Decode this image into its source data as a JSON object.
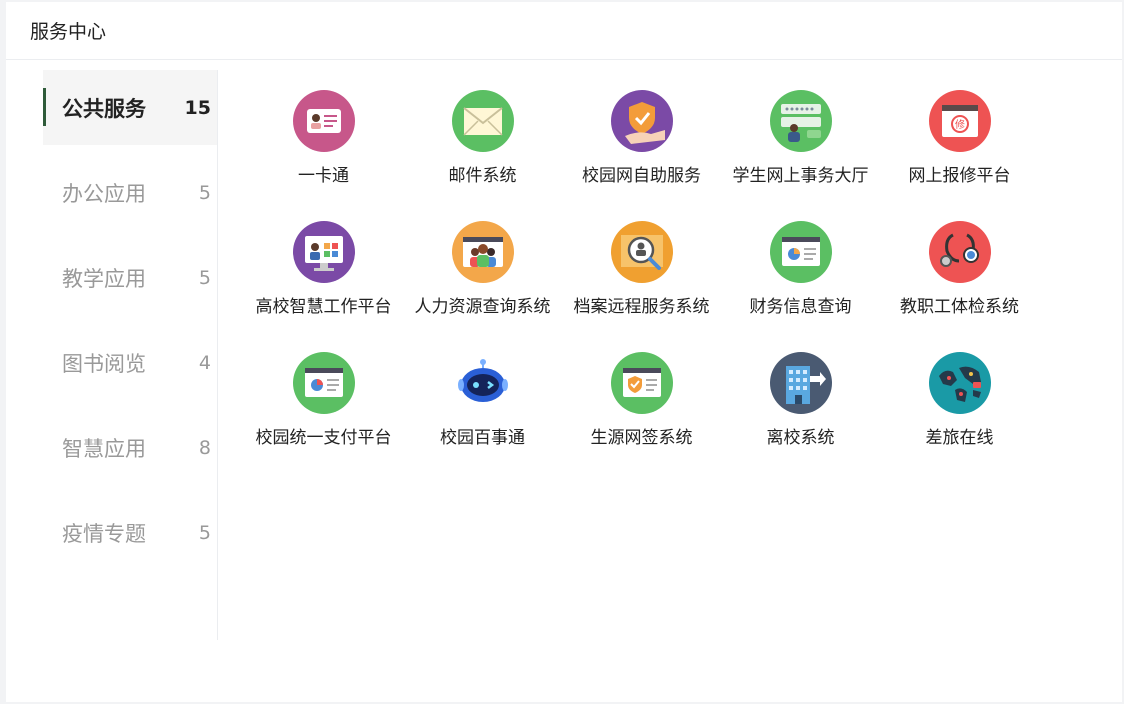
{
  "header": {
    "title": "服务中心"
  },
  "sidebar": {
    "items": [
      {
        "label": "公共服务",
        "count": "15",
        "active": true
      },
      {
        "label": "办公应用",
        "count": "5"
      },
      {
        "label": "教学应用",
        "count": "5"
      },
      {
        "label": "图书阅览",
        "count": "4"
      },
      {
        "label": "智慧应用",
        "count": "8"
      },
      {
        "label": "疫情专题",
        "count": "5"
      }
    ]
  },
  "apps": [
    {
      "label": "一卡通",
      "icon": "id-card-icon",
      "color": "#c7578a"
    },
    {
      "label": "邮件系统",
      "icon": "envelope-icon",
      "color": "#5bbf63"
    },
    {
      "label": "校园网自助服务",
      "icon": "shield-hand-icon",
      "color": "#7b4aa6"
    },
    {
      "label": "学生网上事务大厅",
      "icon": "login-form-icon",
      "color": "#5bbf63"
    },
    {
      "label": "网上报修平台",
      "icon": "repair-window-icon",
      "color": "#ee5353"
    },
    {
      "label": "高校智慧工作平台",
      "icon": "monitor-user-icon",
      "color": "#7b4aa6"
    },
    {
      "label": "人力资源查询系统",
      "icon": "video-people-icon",
      "color": "#f3a74a"
    },
    {
      "label": "档案远程服务系统",
      "icon": "magnifier-person-icon",
      "color": "#f0a030"
    },
    {
      "label": "财务信息查询",
      "icon": "chart-window-icon",
      "color": "#5bbf63"
    },
    {
      "label": "教职工体检系统",
      "icon": "stethoscope-icon",
      "color": "#ee5353"
    },
    {
      "label": "校园统一支付平台",
      "icon": "chart-window-icon",
      "color": "#5bbf63"
    },
    {
      "label": "校园百事通",
      "icon": "robot-icon",
      "color": "#ffffff"
    },
    {
      "label": "生源网签系统",
      "icon": "shield-window-icon",
      "color": "#5bbf63"
    },
    {
      "label": "离校系统",
      "icon": "building-exit-icon",
      "color": "#4a5a72"
    },
    {
      "label": "差旅在线",
      "icon": "world-map-icon",
      "color": "#1a9aa6"
    }
  ]
}
